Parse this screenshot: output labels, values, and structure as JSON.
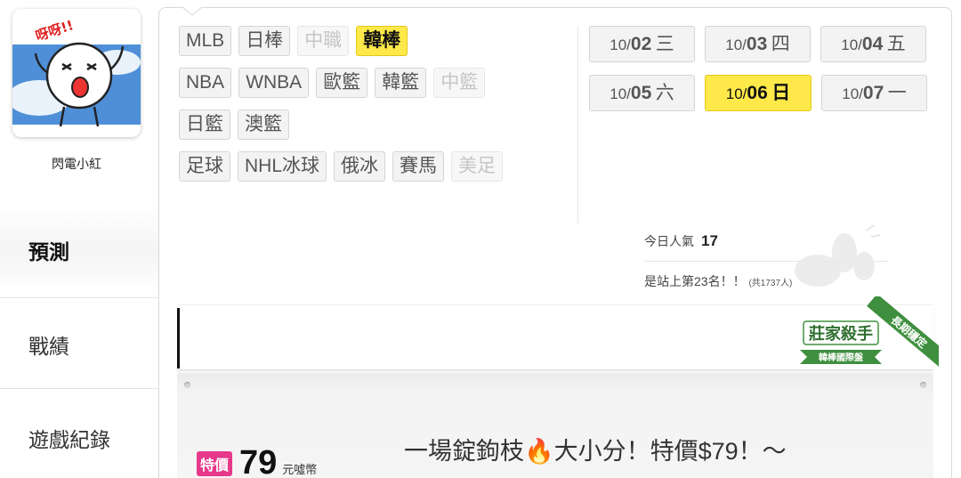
{
  "sidebar": {
    "username": "閃電小紅",
    "avatar_text": "呀呀!!",
    "items": [
      {
        "label": "預測",
        "active": true
      },
      {
        "label": "戰績",
        "active": false
      },
      {
        "label": "遊戲紀錄",
        "active": false
      }
    ]
  },
  "sports": {
    "rows": [
      [
        {
          "label": "MLB",
          "state": "normal"
        },
        {
          "label": "日棒",
          "state": "normal"
        },
        {
          "label": "中職",
          "state": "disabled"
        },
        {
          "label": "韓棒",
          "state": "active"
        }
      ],
      [
        {
          "label": "NBA",
          "state": "normal"
        },
        {
          "label": "WNBA",
          "state": "normal"
        },
        {
          "label": "歐籃",
          "state": "normal"
        },
        {
          "label": "韓籃",
          "state": "normal"
        },
        {
          "label": "中籃",
          "state": "disabled"
        }
      ],
      [
        {
          "label": "日籃",
          "state": "normal"
        },
        {
          "label": "澳籃",
          "state": "normal"
        }
      ],
      [
        {
          "label": "足球",
          "state": "normal"
        },
        {
          "label": "NHL冰球",
          "state": "normal"
        },
        {
          "label": "俄冰",
          "state": "normal"
        },
        {
          "label": "賽馬",
          "state": "normal"
        },
        {
          "label": "美足",
          "state": "disabled"
        }
      ]
    ]
  },
  "dates": {
    "rows": [
      [
        {
          "month": "10/",
          "day": "02",
          "weekday": "三",
          "active": false
        },
        {
          "month": "10/",
          "day": "03",
          "weekday": "四",
          "active": false
        },
        {
          "month": "10/",
          "day": "04",
          "weekday": "五",
          "active": false
        }
      ],
      [
        {
          "month": "10/",
          "day": "05",
          "weekday": "六",
          "active": false
        },
        {
          "month": "10/",
          "day": "06",
          "weekday": "日",
          "active": true
        },
        {
          "month": "10/",
          "day": "07",
          "weekday": "一",
          "active": false
        }
      ]
    ]
  },
  "popularity": {
    "label": "今日人氣",
    "value": "17",
    "rank_text": "是站上第23名！！",
    "total_text": "(共1737人)"
  },
  "badge": {
    "title": "莊家殺手",
    "subtitle": "韓棒國際盤",
    "ribbon": "長期穩定"
  },
  "pick": {
    "sale_label": "特價",
    "price": "79",
    "unit": "元噓幣",
    "title": "一場錠鉤枝🔥大小分！特價$79！～"
  },
  "colors": {
    "active_yellow": "#ffe94a",
    "sale_pink": "#e8388a",
    "badge_green": "#3f8f3f"
  }
}
